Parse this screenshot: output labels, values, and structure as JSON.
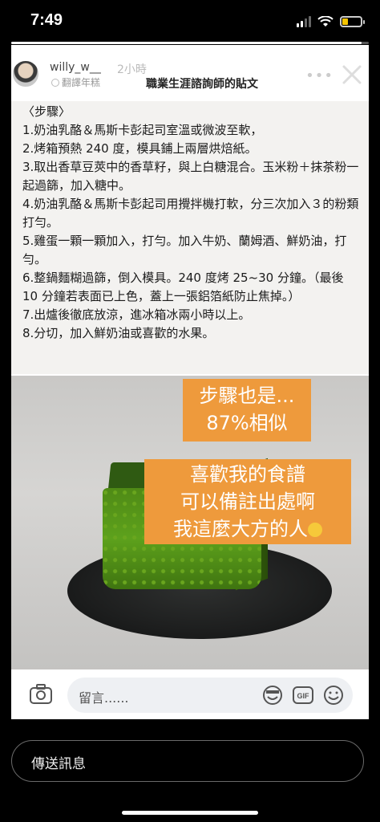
{
  "status_bar": {
    "time": "7:49",
    "battery_level": 0.3,
    "battery_color": "#f5c400"
  },
  "story": {
    "progress": 0.98,
    "username": "willy_w__",
    "time": "2小時",
    "translate_label": "翻譯年糕",
    "post_title": "職業生涯諮詢師的貼文",
    "more_icon": "ellipsis-icon",
    "close_icon": "close-icon"
  },
  "steps": {
    "heading": "〈步驟〉",
    "items": [
      "1.奶油乳酪＆馬斯卡彭起司室溫或微波至軟，",
      "2.烤箱預熱 240 度，模具鋪上兩層烘焙紙。",
      "3.取出香草豆莢中的香草籽，與上白糖混合。玉米粉＋抹茶粉一起過篩，加入糖中。",
      "4.奶油乳酪＆馬斯卡彭起司用攪拌機打軟，分三次加入３的粉類打勻。",
      "5.雞蛋一顆一顆加入，打勻。加入牛奶、蘭姆酒、鮮奶油，打勻。",
      "6.整鍋麵糊過篩，倒入模具。240 度烤 25~30 分鐘。（最後 10 分鐘若表面已上色，蓋上一張鋁箔紙防止焦掉。）",
      "7.出爐後徹底放涼，進冰箱冰兩小時以上。",
      "8.分切，加入鮮奶油或喜歡的水果。"
    ]
  },
  "overlay": {
    "box1_line1": "步驟也是...",
    "box1_line2": "87%相似",
    "box2_line1": "喜歡我的食譜",
    "box2_line2": "可以備註出處啊",
    "box2_line3": "我這麼大方的人",
    "accent_color": "#ee9a3c"
  },
  "comment_bar": {
    "placeholder": "留言......",
    "icons": [
      "camera-icon",
      "sticker-icon",
      "gif-icon",
      "emoji-icon"
    ]
  },
  "send_message": {
    "placeholder": "傳送訊息"
  }
}
